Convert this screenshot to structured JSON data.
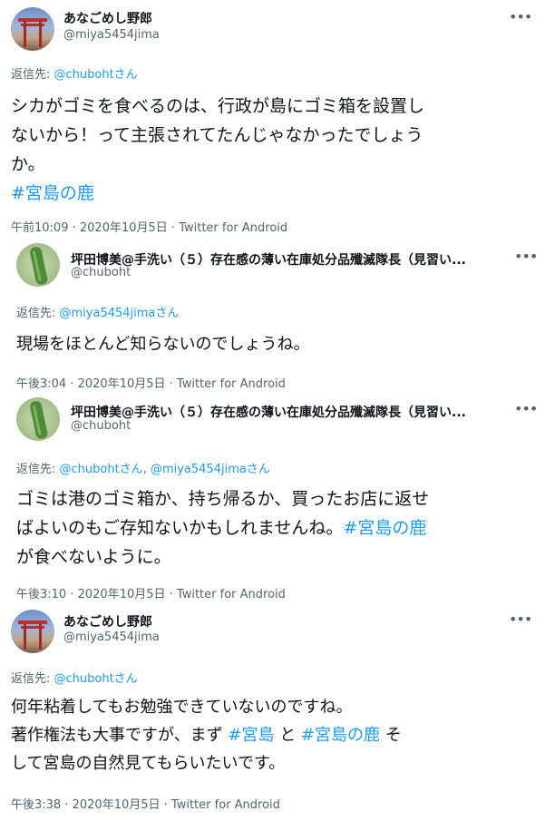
{
  "tweets": [
    {
      "name": "あなごめし野郎",
      "handle": "@miya5454jima",
      "reply_prefix": "返信先: ",
      "reply_mention": "@chubohtさん",
      "line1": "シカがゴミを食べるのは、行政が島にゴミ箱を設置し",
      "line2": "ないから！って主張されてたんじゃなかったでしょう",
      "line3": "か。",
      "tag": "#宮島の鹿",
      "time": "午前10:09",
      "date": "2020年10月5日",
      "source": "Twitter for Android"
    },
    {
      "name": "坪田博美@手洗い（５）存在感の薄い在庫処分品殲滅隊長（見習い...",
      "handle": "@chuboht",
      "reply_prefix": "返信先: ",
      "reply_mention": "@miya5454jimaさん",
      "line1": "現場をほとんど知らないのでしょうね。",
      "time": "午後3:04",
      "date": "2020年10月5日",
      "source": "Twitter for Android"
    },
    {
      "name": "坪田博美@手洗い（５）存在感の薄い在庫処分品殲滅隊長（見習い...",
      "handle": "@chuboht",
      "reply_prefix": "返信先: ",
      "reply_mention1": "@chubohtさん",
      "reply_sep": ", ",
      "reply_mention2": "@miya5454jimaさん",
      "line1": "ゴミは港のゴミ箱か、持ち帰るか、買ったお店に返せ",
      "line2": "ばよいのもご存知ないかもしれませんね。",
      "line2_tag": "#宮島の鹿",
      "line3": "が食べないように。",
      "time": "午後3:10",
      "date": "2020年10月5日",
      "source": "Twitter for Android"
    },
    {
      "name": "あなごめし野郎",
      "handle": "@miya5454jima",
      "reply_prefix": "返信先: ",
      "reply_mention": "@chubohtさん",
      "line1": "何年粘着してもお勉強できていないのですね。",
      "line2_a": "著作権法も大事ですが、まず ",
      "line2_tag1": "#宮島",
      "line2_b": " と ",
      "line2_tag2": "#宮島の鹿",
      "line2_c": " そ",
      "line3": "して宮島の自然見てもらいたいです。",
      "time": "午後3:38",
      "date": "2020年10月5日",
      "source": "Twitter for Android"
    }
  ],
  "meta_sep": " · ",
  "more_glyph": "•••"
}
